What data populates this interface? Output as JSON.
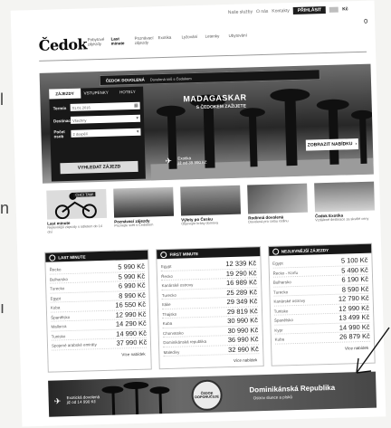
{
  "header": {
    "top_links": [
      "Naše služby",
      "O nás",
      "Kontakty"
    ],
    "login_label": "PŘIHLÁSIT",
    "currency": "Kč",
    "count": "0",
    "logo": "Čedok",
    "nav": [
      {
        "label": "Pobytové zájezdy"
      },
      {
        "label": "Last minute",
        "strong": true
      },
      {
        "label": "Poznávací zájezdy"
      },
      {
        "label": "Exotika"
      },
      {
        "label": "Lyžování"
      },
      {
        "label": "Letenky"
      },
      {
        "label": "Ubytování"
      }
    ]
  },
  "hero": {
    "strip_brand": "ČEDOK DOVOLENÁ",
    "strip_text": "Dovolená snů s Čedokem",
    "headline": "MADAGASKAR",
    "subline": "S ČEDOKEM ZAŽIJETE",
    "from_line1": "Exotika",
    "from_line2": "již od 39 990 Kč",
    "cta_label": "ZOBRAZIT NABÍDKU",
    "cta_icon": "chevron-right-icon"
  },
  "search": {
    "tabs": [
      "ZÁJEZDY",
      "VSTUPENKY",
      "HOTELY"
    ],
    "rows": [
      {
        "label": "Termín",
        "value": "01.01.2016",
        "icon": "calendar-icon"
      },
      {
        "label": "Destinace",
        "value": "Všechny",
        "icon": "chevron-down-icon"
      },
      {
        "label": "Počet osob",
        "value": "2 dospělí",
        "icon": "chevron-down-icon"
      }
    ],
    "button_label": "VYHLEDAT ZÁJEZD"
  },
  "tiles": [
    {
      "caption": "Last minute",
      "desc": "Nejlevnější zájezdy s odletem do 14 dní",
      "overlay": "CHCI TAM!"
    },
    {
      "caption": "Poznávací zájezdy",
      "desc": "Poznejte svět s Čedokem"
    },
    {
      "caption": "Výlety po Česku",
      "desc": "Objevujte krásy domova"
    },
    {
      "caption": "Rodinná dovolená",
      "desc": "Dovolená pro celou rodinu"
    },
    {
      "caption": "Čedok Exotika",
      "desc": "Vzdálené destinace za skvělé ceny"
    }
  ],
  "price_columns": [
    {
      "title": "LAST MINUTE",
      "icon": "clock-icon",
      "rows": [
        {
          "dest": "Řecko",
          "price": "5 990 Kč"
        },
        {
          "dest": "Bulharsko",
          "price": "5 990 Kč"
        },
        {
          "dest": "Turecko",
          "price": "6 990 Kč"
        },
        {
          "dest": "Egypt",
          "price": "8 990 Kč"
        },
        {
          "dest": "Kuba",
          "price": "16 550 Kč"
        },
        {
          "dest": "Španělsko",
          "price": "12 990 Kč"
        },
        {
          "dest": "Mallorca",
          "price": "14 290 Kč"
        },
        {
          "dest": "Tunisko",
          "price": "14 990 Kč"
        },
        {
          "dest": "Spojené arabské emiráty",
          "price": "37 990 Kč"
        }
      ],
      "more_label": "Více nabídek"
    },
    {
      "title": "FIRST MINUTE",
      "icon": "calendar-icon",
      "rows": [
        {
          "dest": "Egypt",
          "price": "12 339 Kč"
        },
        {
          "dest": "Řecko",
          "price": "19 290 Kč"
        },
        {
          "dest": "Kanárské ostrovy",
          "price": "16 989 Kč"
        },
        {
          "dest": "Turecko",
          "price": "25 289 Kč"
        },
        {
          "dest": "Itálie",
          "price": "29 349 Kč"
        },
        {
          "dest": "Thajsko",
          "price": "29 819 Kč"
        },
        {
          "dest": "Kuba",
          "price": "30 990 Kč"
        },
        {
          "dest": "Chorvatsko",
          "price": "30 990 Kč"
        },
        {
          "dest": "Dominikánská republika",
          "price": "36 990 Kč"
        },
        {
          "dest": "Maledivy",
          "price": "32 990 Kč"
        }
      ],
      "more_label": "Více nabídek"
    },
    {
      "title": "NEJLEVNĚJŠÍ ZÁJEZDY",
      "icon": "percent-icon",
      "rows": [
        {
          "dest": "Egypt",
          "price": "5 100 Kč"
        },
        {
          "dest": "Řecko - Korfu",
          "price": "5 490 Kč"
        },
        {
          "dest": "Bulharsko",
          "price": "6 190 Kč"
        },
        {
          "dest": "Turecko",
          "price": "8 590 Kč"
        },
        {
          "dest": "Kanárské ostrovy",
          "price": "12 790 Kč"
        },
        {
          "dest": "Tunisko",
          "price": "12 990 Kč"
        },
        {
          "dest": "Španělsko",
          "price": "13 499 Kč"
        },
        {
          "dest": "Kypr",
          "price": "14 990 Kč"
        },
        {
          "dest": "Kuba",
          "price": "26 879 Kč"
        }
      ],
      "more_label": "Více nabídek"
    }
  ],
  "banner": {
    "from_line1": "Exotická dovolená",
    "from_line2": "již od 14 990 Kč",
    "seal_text": "ČEDOK DOPORUČUJE",
    "title": "Dominikánská Republika",
    "subtitle": "Ostrov slunce a písků"
  }
}
